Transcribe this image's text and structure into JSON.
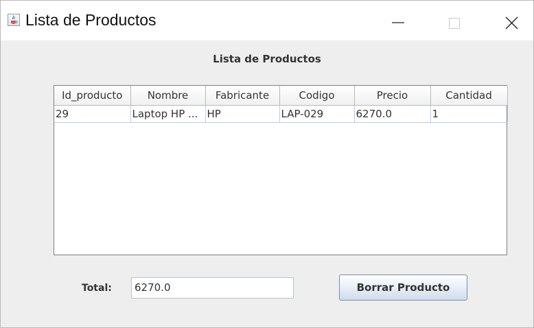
{
  "window": {
    "title": "Lista de Productos",
    "icon": "java-cup-icon"
  },
  "heading": "Lista de Productos",
  "table": {
    "columns": [
      "Id_producto",
      "Nombre",
      "Fabricante",
      "Codigo",
      "Precio",
      "Cantidad"
    ],
    "rows": [
      [
        "29",
        "Laptop HP ...",
        "HP",
        "LAP-029",
        "6270.0",
        "1"
      ]
    ]
  },
  "total": {
    "label": "Total:",
    "value": "6270.0"
  },
  "actions": {
    "delete_label": "Borrar Producto"
  }
}
